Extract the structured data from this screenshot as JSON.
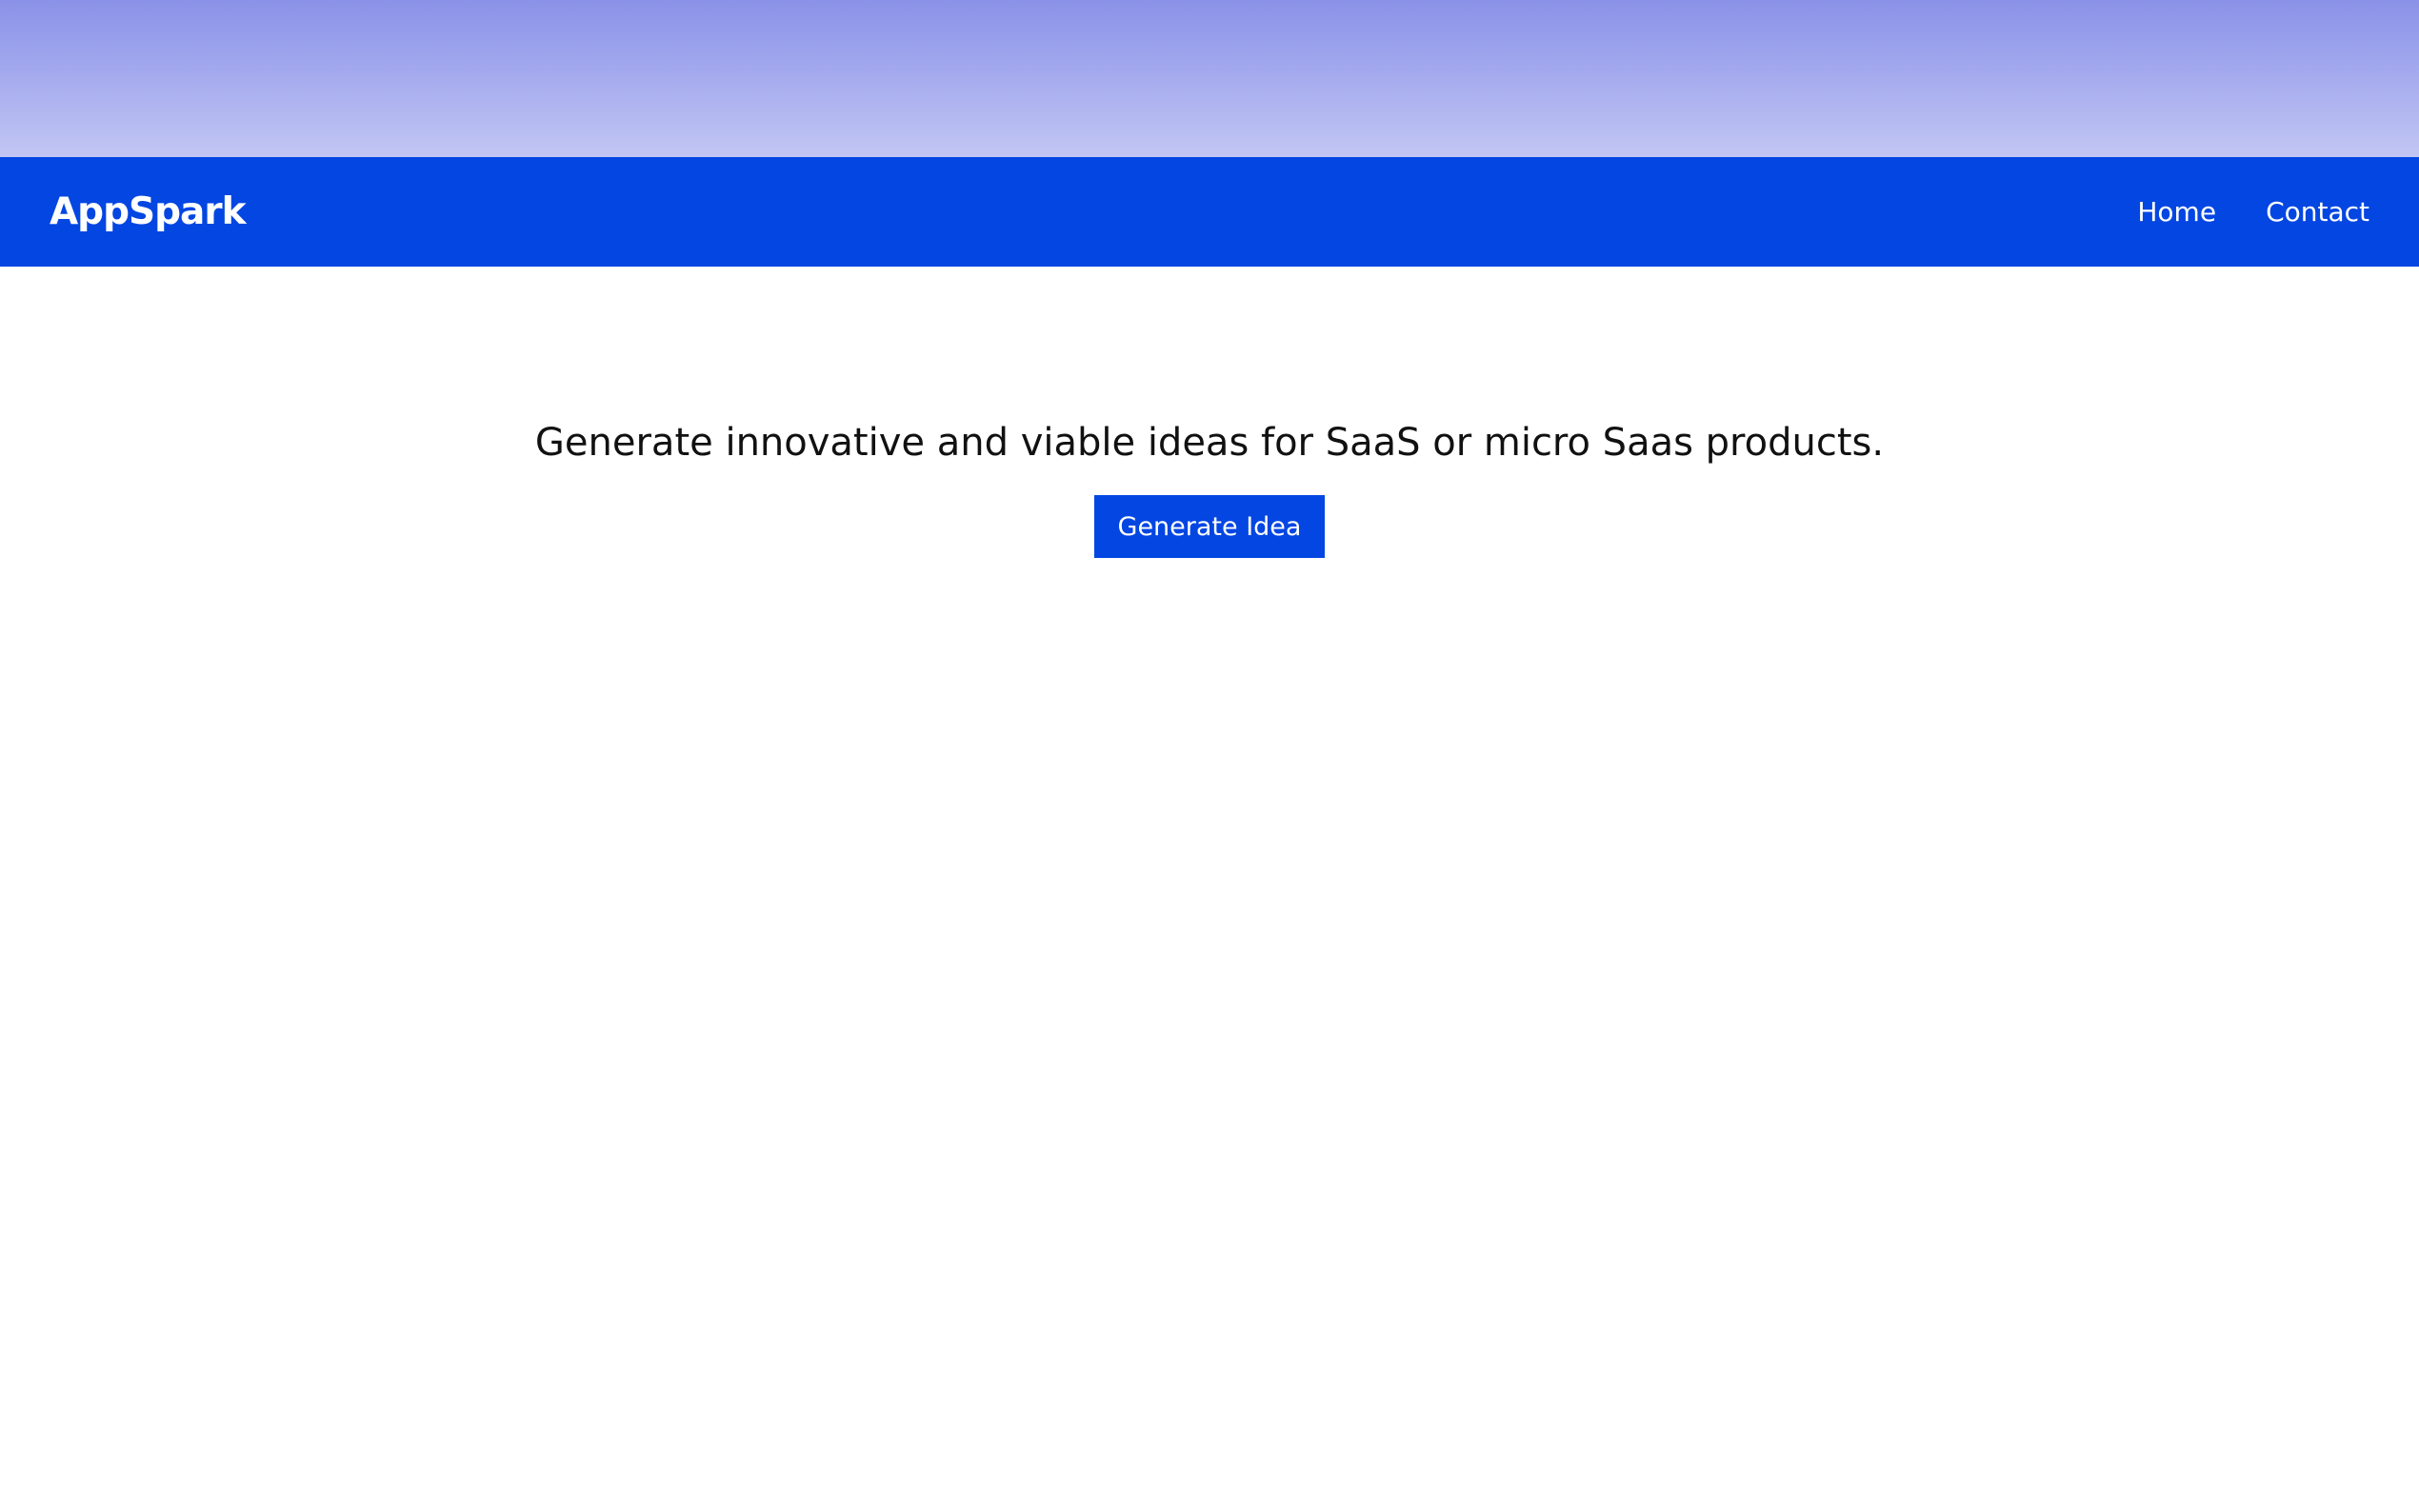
{
  "header": {
    "brand": "AppSpark",
    "nav": [
      {
        "label": "Home"
      },
      {
        "label": "Contact"
      }
    ]
  },
  "main": {
    "tagline": "Generate innovative and viable ideas for SaaS or micro Saas products.",
    "button_label": "Generate Idea"
  },
  "colors": {
    "brand_blue": "#0346e2",
    "gradient_top": "#8a92e8",
    "gradient_bottom": "#c2c6f3",
    "text": "#111111",
    "background": "#ffffff"
  }
}
